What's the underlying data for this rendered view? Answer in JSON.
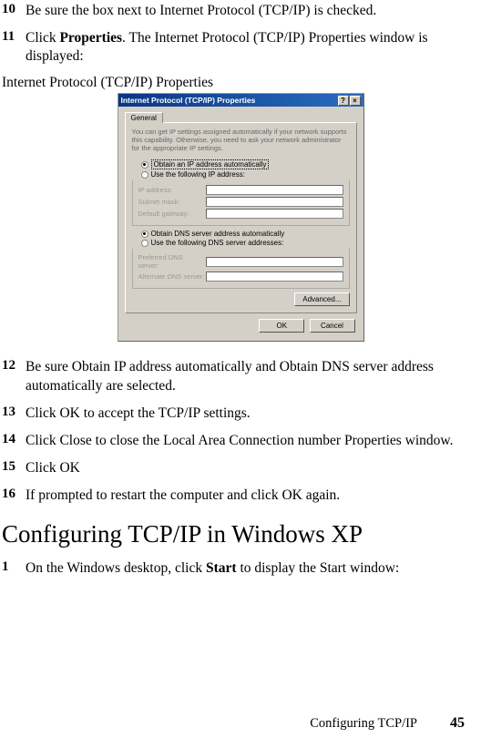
{
  "steps_a": [
    {
      "num": "10",
      "parts": [
        {
          "t": "Be sure the box next to Internet Protocol (TCP/IP) is checked.",
          "b": false
        }
      ]
    },
    {
      "num": "11",
      "parts": [
        {
          "t": "Click ",
          "b": false
        },
        {
          "t": "Properties",
          "b": true
        },
        {
          "t": ". The Internet Protocol (TCP/IP) Properties window is displayed:",
          "b": false
        }
      ]
    }
  ],
  "fig_caption": "Internet Protocol (TCP/IP) Properties",
  "dialog": {
    "title": "Internet Protocol (TCP/IP) Properties",
    "help_btn": "?",
    "close_btn": "×",
    "tab": "General",
    "desc": "You can get IP settings assigned automatically if your network supports this capability. Otherwise, you need to ask your network administrator for the appropriate IP settings.",
    "radio_obtain_ip": "Obtain an IP address automatically",
    "radio_use_ip": "Use the following IP address:",
    "lbl_ip": "IP address:",
    "lbl_subnet": "Subnet mask:",
    "lbl_gateway": "Default gateway:",
    "radio_obtain_dns": "Obtain DNS server address automatically",
    "radio_use_dns": "Use the following DNS server addresses:",
    "lbl_pref_dns": "Preferred DNS server:",
    "lbl_alt_dns": "Alternate DNS server:",
    "btn_advanced": "Advanced...",
    "btn_ok": "OK",
    "btn_cancel": "Cancel"
  },
  "steps_b": [
    {
      "num": "12",
      "parts": [
        {
          "t": "Be sure Obtain IP address automatically and Obtain DNS server address automatically are selected.",
          "b": false
        }
      ]
    },
    {
      "num": "13",
      "parts": [
        {
          "t": "Click OK to accept the TCP/IP settings.",
          "b": false
        }
      ]
    },
    {
      "num": "14",
      "parts": [
        {
          "t": "Click Close to close the Local Area Connection number Properties window.",
          "b": false
        }
      ]
    },
    {
      "num": "15",
      "parts": [
        {
          "t": "Click OK",
          "b": false
        }
      ]
    },
    {
      "num": "16",
      "parts": [
        {
          "t": "If prompted to restart the computer and click OK again.",
          "b": false
        }
      ]
    }
  ],
  "heading": "Configuring TCP/IP in Windows XP",
  "steps_c": [
    {
      "num": "1",
      "parts": [
        {
          "t": "On the Windows desktop, click ",
          "b": false
        },
        {
          "t": "Start",
          "b": true
        },
        {
          "t": " to display the Start window:",
          "b": false
        }
      ]
    }
  ],
  "footer_text": "Configuring TCP/IP",
  "page_num": "45"
}
